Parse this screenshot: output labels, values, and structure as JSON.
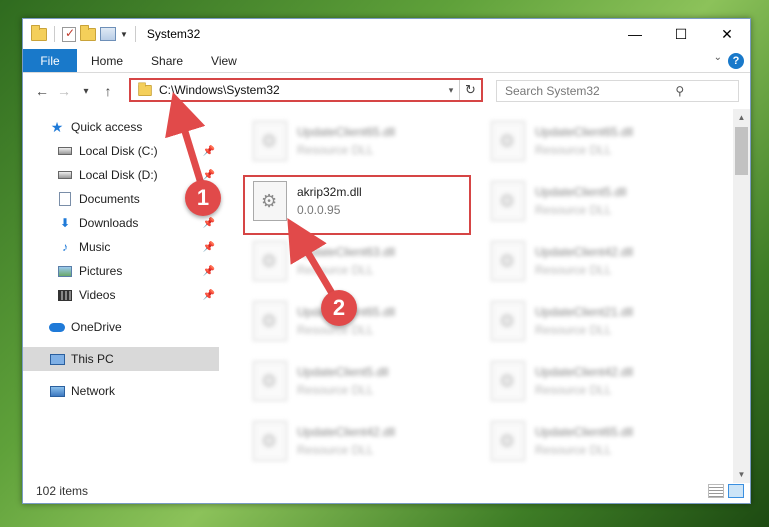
{
  "window": {
    "title": "System32",
    "controls": {
      "minimize": "—",
      "maximize": "☐",
      "close": "✕"
    }
  },
  "ribbon": {
    "tabs": [
      {
        "label": "File"
      },
      {
        "label": "Home"
      },
      {
        "label": "Share"
      },
      {
        "label": "View"
      }
    ],
    "help": "?"
  },
  "nav": {
    "back": "←",
    "forward": "→",
    "recent": "▾",
    "up": "↑",
    "address": "C:\\Windows\\System32",
    "address_chevron": "▾",
    "refresh": "↻",
    "search_placeholder": "Search System32",
    "search_icon": "⚲"
  },
  "sidebar": {
    "items": [
      {
        "label": "Quick access",
        "icon": "star-icon"
      },
      {
        "label": "Local Disk (C:)",
        "icon": "disk-icon",
        "pinned": true
      },
      {
        "label": "Local Disk (D:)",
        "icon": "disk-icon",
        "pinned": true
      },
      {
        "label": "Documents",
        "icon": "documents-icon",
        "pinned": true
      },
      {
        "label": "Downloads",
        "icon": "downloads-icon",
        "pinned": true
      },
      {
        "label": "Music",
        "icon": "music-icon",
        "pinned": true
      },
      {
        "label": "Pictures",
        "icon": "pictures-icon",
        "pinned": true
      },
      {
        "label": "Videos",
        "icon": "videos-icon",
        "pinned": true
      },
      {
        "label": "OneDrive",
        "icon": "onedrive-icon"
      },
      {
        "label": "This PC",
        "icon": "this-pc-icon",
        "selected": true
      },
      {
        "label": "Network",
        "icon": "network-icon"
      }
    ],
    "pin_glyph": "📌"
  },
  "files": [
    {
      "name": "UpdateClient65.dll",
      "type": "Resource DLL",
      "blurred": true
    },
    {
      "name": "UpdateClient65.dll",
      "type": "Resource DLL",
      "blurred": true
    },
    {
      "name": "akrip32m.dll",
      "type": "0.0.0.95",
      "blurred": false
    },
    {
      "name": "UpdateClient5.dll",
      "type": "Resource DLL",
      "blurred": true
    },
    {
      "name": "UpdateClient63.dll",
      "type": "Resource DLL",
      "blurred": true
    },
    {
      "name": "UpdateClient42.dll",
      "type": "Resource DLL",
      "blurred": true
    },
    {
      "name": "UpdateClient65.dll",
      "type": "Resource DLL",
      "blurred": true
    },
    {
      "name": "UpdateClient21.dll",
      "type": "Resource DLL",
      "blurred": true
    },
    {
      "name": "UpdateClient5.dll",
      "type": "Resource DLL",
      "blurred": true
    },
    {
      "name": "UpdateClient42.dll",
      "type": "Resource DLL",
      "blurred": true
    },
    {
      "name": "UpdateClient42.dll",
      "type": "Resource DLL",
      "blurred": true
    },
    {
      "name": "UpdateClient65.dll",
      "type": "Resource DLL",
      "blurred": true
    }
  ],
  "status": {
    "items": "102 items"
  },
  "callouts": {
    "one": "1",
    "two": "2"
  },
  "colors": {
    "accent": "#1979ca",
    "callout": "#e14a4a",
    "highlight": "#d64545"
  }
}
